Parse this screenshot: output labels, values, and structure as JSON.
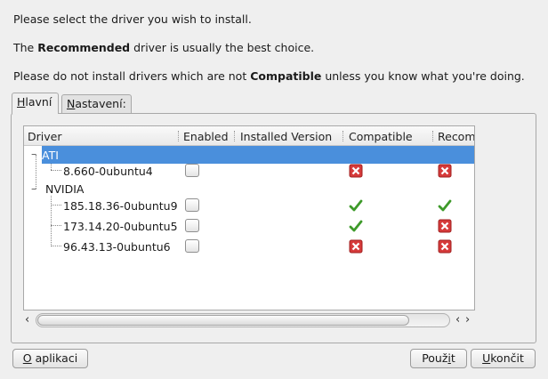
{
  "messages": {
    "line1": "Please select the driver you wish to install.",
    "line2_pre": "The ",
    "line2_bold": "Recommended",
    "line2_post": " driver is usually the best choice.",
    "line3_pre": "Please do not install drivers which are not ",
    "line3_bold": "Compatible",
    "line3_post": " unless you know what you're doing."
  },
  "tabs": [
    {
      "mnemonic": "H",
      "rest": "lavní"
    },
    {
      "mnemonic": "N",
      "rest": "astavení:"
    }
  ],
  "columns": [
    "Driver",
    "Enabled",
    "Installed Version",
    "Compatible",
    "Recom"
  ],
  "groups": [
    {
      "name": "ATI",
      "drivers": [
        {
          "version": "8.660-0ubuntu4",
          "enabled": false,
          "installed": "",
          "compatible": "no",
          "recommended": "no"
        }
      ]
    },
    {
      "name": "NVIDIA",
      "drivers": [
        {
          "version": "185.18.36-0ubuntu9",
          "enabled": false,
          "installed": "",
          "compatible": "yes",
          "recommended": "yes"
        },
        {
          "version": "173.14.20-0ubuntu5",
          "enabled": false,
          "installed": "",
          "compatible": "yes",
          "recommended": "no"
        },
        {
          "version": "96.43.13-0ubuntu6",
          "enabled": false,
          "installed": "",
          "compatible": "no",
          "recommended": "no"
        }
      ]
    }
  ],
  "buttons": {
    "about_mnemonic": "O",
    "about_rest": " aplikaci",
    "use_pre": "Použ",
    "use_mnemonic": "i",
    "use_post": "t",
    "quit_mnemonic": "U",
    "quit_rest": "končit"
  },
  "colors": {
    "selection": "#4a8fdc",
    "check": "#3e9a2a",
    "cross": "#d63a3a"
  },
  "icons": {
    "yes": "check-icon",
    "no": "cross-icon"
  }
}
